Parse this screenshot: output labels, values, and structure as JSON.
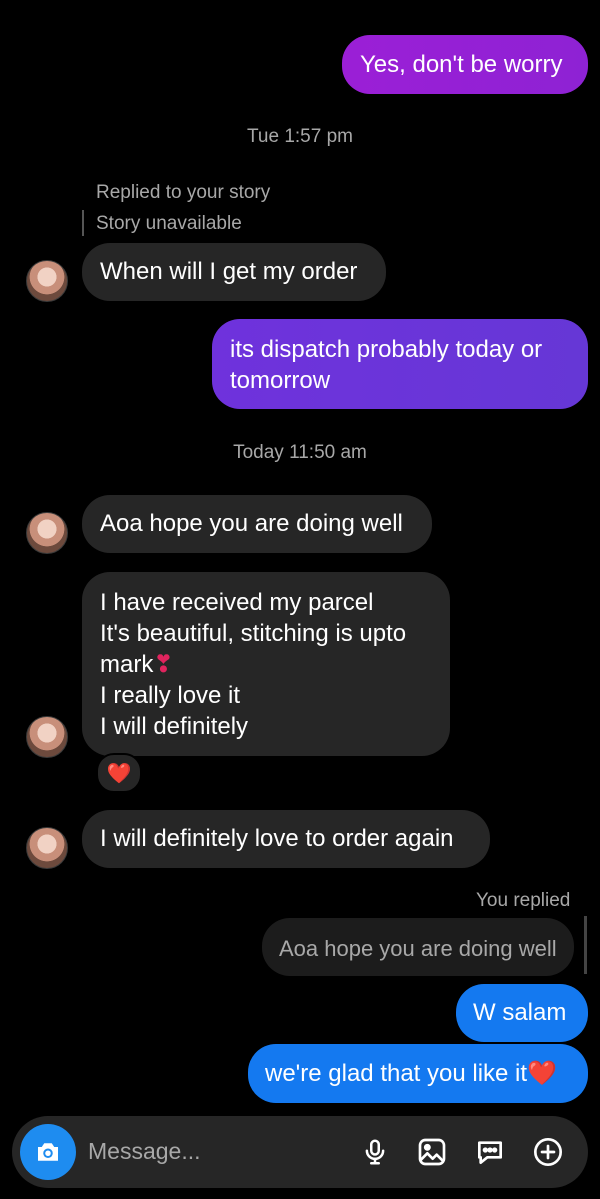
{
  "messages": {
    "m1": "Yes, don't be worry",
    "ts1": "Tue 1:57 pm",
    "replied_story": "Replied to your story",
    "story_unavailable": "Story unavailable",
    "m2": "When will I get my order",
    "m3_line1": "its dispatch probably today or",
    "m3_line2": "tomorrow",
    "ts2": "Today 11:50 am",
    "m4": "Aoa hope you are doing well",
    "m5_lines": [
      "I have received my parcel",
      "It's beautiful, stitching is upto",
      "mark",
      "I really love it",
      "I will definitely"
    ],
    "m5_mark_emoji": "❣",
    "reaction": "❤️",
    "m6": "I will definitely love to order again",
    "you_replied": "You replied",
    "quoted": "Aoa hope you are doing well",
    "m7": "W salam",
    "m8": "we're glad that you like it",
    "m8_emoji": "❤️"
  },
  "composer": {
    "placeholder": "Message...",
    "icons": [
      "camera-icon",
      "microphone-icon",
      "gallery-icon",
      "sticker-chat-icon",
      "add-icon"
    ]
  },
  "colors": {
    "bubble_purple": "#8a1fd0",
    "bubble_violet": "#6a35d9",
    "bubble_blue": "#1479f0",
    "incoming": "#262626",
    "accent_camera": "#1e8cf0"
  }
}
